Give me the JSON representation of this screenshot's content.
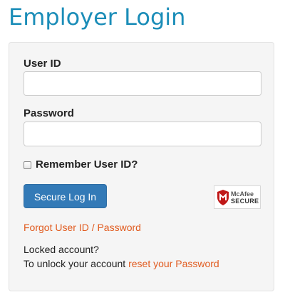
{
  "header": {
    "title": "Employer Login"
  },
  "form": {
    "user_id": {
      "label": "User ID",
      "value": "",
      "placeholder": ""
    },
    "password": {
      "label": "Password",
      "value": "",
      "placeholder": ""
    },
    "remember": {
      "label": "Remember User ID?",
      "checked": false
    },
    "submit_label": "Secure Log In"
  },
  "badge": {
    "brand": "McAfee",
    "subtitle": "SECURE",
    "shield_color": "#c01818",
    "icon": "mcafee-shield-icon"
  },
  "links": {
    "forgot": "Forgot User ID / Password",
    "locked_text": "Locked account?",
    "unlock_prefix": "To unlock your account ",
    "reset_link": "reset your Password"
  },
  "colors": {
    "title": "#1b8db8",
    "primary_button": "#337ab7",
    "link": "#e15b1f",
    "panel_background": "#f5f5f5"
  }
}
